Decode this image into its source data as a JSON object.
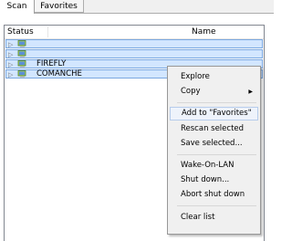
{
  "tabs": [
    {
      "label": "Scan"
    },
    {
      "label": "Favorites"
    }
  ],
  "list": {
    "headers": {
      "status": "Status",
      "name": "Name"
    },
    "rows": [
      {
        "label": ""
      },
      {
        "label": ""
      },
      {
        "label": "FIREFLY"
      },
      {
        "label": "COMANCHE"
      }
    ]
  },
  "context_menu": {
    "explore": "Explore",
    "copy": "Copy",
    "add_to_favorites": "Add to \"Favorites\"",
    "rescan_selected": "Rescan selected",
    "save_selected": "Save selected...",
    "wake_on_lan": "Wake-On-LAN",
    "shut_down": "Shut down...",
    "abort_shut_down": "Abort shut down",
    "clear_list": "Clear list"
  },
  "colors": {
    "selection": "#d2e6ff",
    "selection_border": "#7aa7e0",
    "menu_bg": "#f0f0f0"
  }
}
